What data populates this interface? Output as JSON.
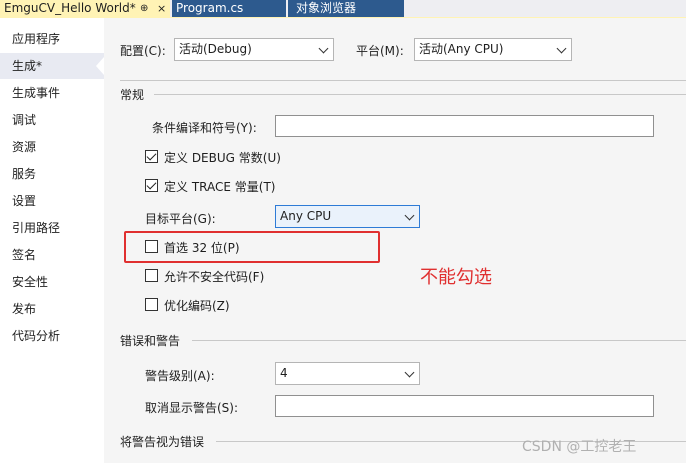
{
  "tabs": [
    {
      "label": "EmguCV_Hello World*",
      "pin": "⊕",
      "close": "×"
    },
    {
      "label": "Program.cs"
    },
    {
      "label": "对象浏览器"
    }
  ],
  "nav": {
    "items": [
      "应用程序",
      "生成*",
      "生成事件",
      "调试",
      "资源",
      "服务",
      "设置",
      "引用路径",
      "签名",
      "安全性",
      "发布",
      "代码分析"
    ],
    "selected": "生成*"
  },
  "config": {
    "config_label": "配置(C):",
    "config_value": "活动(Debug)",
    "platform_label": "平台(M):",
    "platform_value": "活动(Any CPU)"
  },
  "general": {
    "section": "常规",
    "symbols_label": "条件编译和符号(Y):",
    "symbols_value": "",
    "debug_const": "定义 DEBUG 常数(U)",
    "trace_const": "定义 TRACE 常量(T)",
    "target_label": "目标平台(G):",
    "target_value": "Any CPU",
    "prefer32": "首选 32 位(P)",
    "unsafe": "允许不安全代码(F)",
    "optimize": "优化编码(Z)"
  },
  "checkbox_states": {
    "debug": true,
    "trace": true,
    "prefer32": false,
    "unsafe": false,
    "optimize": false
  },
  "errors": {
    "section": "错误和警告",
    "warn_level_label": "警告级别(A):",
    "warn_level_value": "4",
    "suppress_label": "取消显示警告(S):",
    "suppress_value": ""
  },
  "treat_section": "将警告视为错误",
  "annotation": "不能勾选",
  "watermark": "CSDN @工控老王",
  "colors": {
    "accent_tab": "#2d5a8e",
    "active_tab": "#fff3b5",
    "annotation": "#e03030",
    "combo_focus": "#2e7bd6"
  }
}
